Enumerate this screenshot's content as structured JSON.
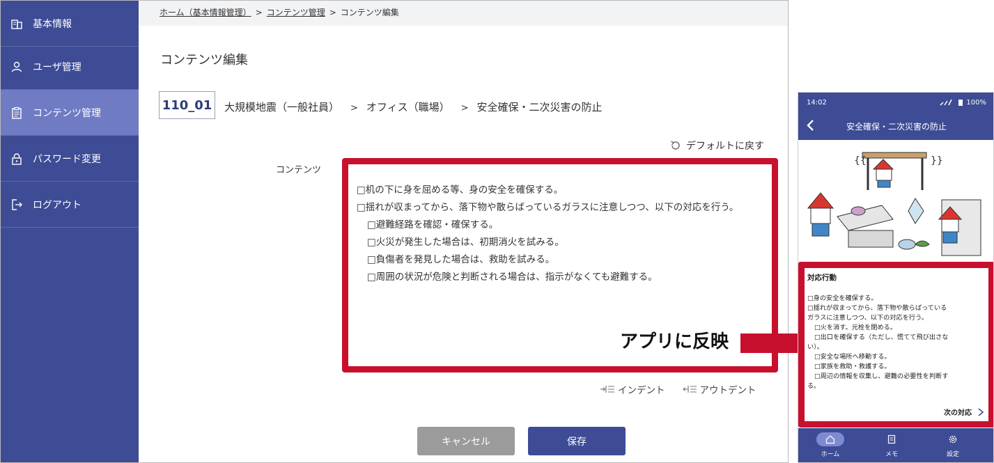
{
  "sidebar": {
    "items": [
      {
        "label": "基本情報",
        "icon": "building-icon"
      },
      {
        "label": "ユーザ管理",
        "icon": "user-icon"
      },
      {
        "label": "コンテンツ管理",
        "icon": "clipboard-icon",
        "active": true
      },
      {
        "label": "パスワード変更",
        "icon": "lock-icon"
      },
      {
        "label": "ログアウト",
        "icon": "logout-icon"
      }
    ]
  },
  "breadcrumb": {
    "items": [
      "ホーム（基本情報管理）",
      "コンテンツ管理",
      "コンテンツ編集"
    ],
    "separator": ">"
  },
  "page": {
    "title": "コンテンツ編集",
    "content_id": "110_01",
    "path": [
      "大規模地震（一般社員）",
      "オフィス（職場）",
      "安全確保・二次災害の防止"
    ],
    "path_separator": ">",
    "reset_label": "デフォルトに戻す",
    "field_label": "コンテンツ",
    "editor_lines": [
      {
        "text": "□机の下に身を屈める等、身の安全を確保する。",
        "indent": false
      },
      {
        "text": "□揺れが収まってから、落下物や散らばっているガラスに注意しつつ、以下の対応を行う。",
        "indent": false
      },
      {
        "text": "□避難経路を確認・確保する。",
        "indent": true
      },
      {
        "text": "□火災が発生した場合は、初期消火を試みる。",
        "indent": true
      },
      {
        "text": "□負傷者を発見した場合は、救助を試みる。",
        "indent": true
      },
      {
        "text": "□周囲の状況が危険と判断される場合は、指示がなくても避難する。",
        "indent": true
      }
    ],
    "indent_label": "インデント",
    "outdent_label": "アウトデント",
    "cancel_label": "キャンセル",
    "save_label": "保存"
  },
  "callout": {
    "text": "アプリに反映"
  },
  "phone": {
    "status_time": "14:02",
    "battery": "100%",
    "header_title": "安全確保・二次災害の防止",
    "section_title": "対応行動",
    "lines": [
      {
        "text": "□身の安全を確保する。",
        "indent": false
      },
      {
        "text": "□揺れが収まってから、落下物や散らばっている",
        "indent": false
      },
      {
        "text": "ガラスに注意しつつ、以下の対応を行う。",
        "indent": false
      },
      {
        "text": "□火を消す。元栓を閉める。",
        "indent": true
      },
      {
        "text": "□出口を確保する（ただし、慌てて飛び出さな",
        "indent": true
      },
      {
        "text": "い）。",
        "indent": false
      },
      {
        "text": "□安全な場所へ移動する。",
        "indent": true
      },
      {
        "text": "□家族を救助・救護する。",
        "indent": true
      },
      {
        "text": "□周辺の情報を収集し、避難の必要性を判断す",
        "indent": true
      },
      {
        "text": "る。",
        "indent": false
      }
    ],
    "next_label": "次の対応",
    "tabs": [
      {
        "label": "ホーム",
        "icon": "home-icon",
        "active": true
      },
      {
        "label": "メモ",
        "icon": "memo-icon"
      },
      {
        "label": "設定",
        "icon": "gear-icon"
      }
    ]
  },
  "colors": {
    "sidebar": "#3d4c94",
    "sidebar_active": "#6f7cc3",
    "highlight_red": "#c8102e",
    "cancel_button": "#9b9b9b",
    "save_button": "#3d4c94"
  }
}
